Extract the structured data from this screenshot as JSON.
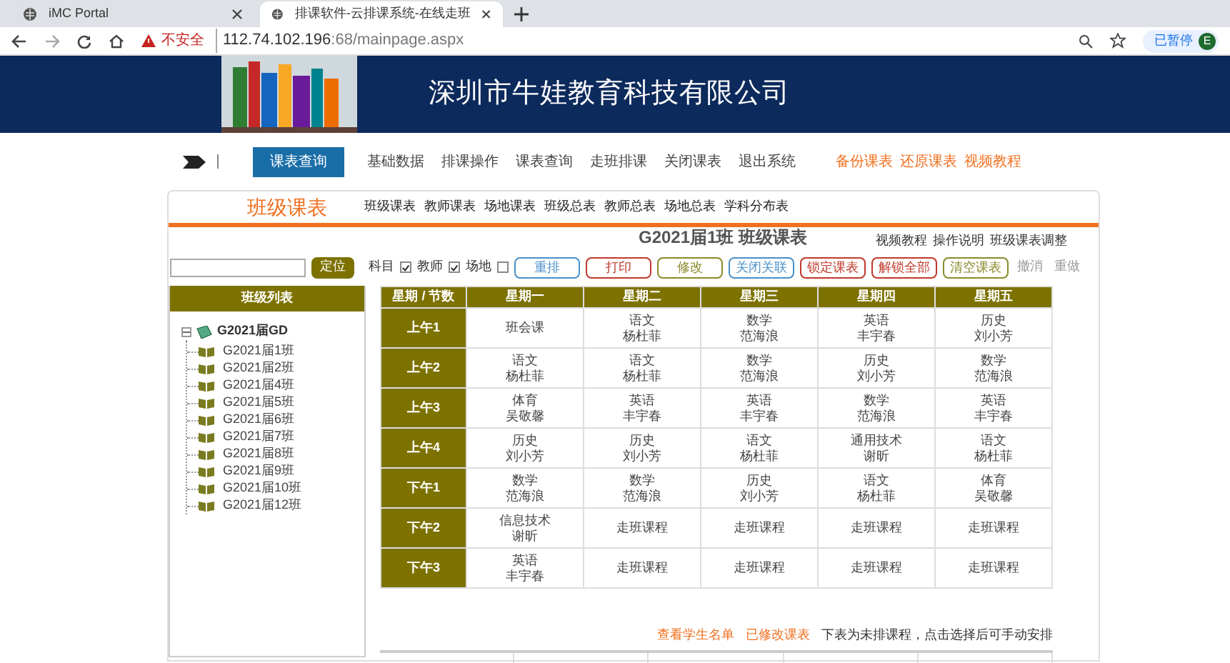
{
  "browser": {
    "tabs": [
      {
        "title": "iMC Portal",
        "selected": false
      },
      {
        "title": "排课软件-云排课系统-在线走班",
        "selected": true
      }
    ],
    "address": {
      "warning": "不安全",
      "host": "112.74.102.196",
      "rest": ":68/mainpage.aspx"
    },
    "profile": "已暂停",
    "avatar": "E"
  },
  "header": {
    "title": "深圳市牛娃教育科技有限公司"
  },
  "nav": {
    "items": [
      {
        "label": "课表查询",
        "selected": true
      },
      {
        "label": "基础数据",
        "selected": false
      },
      {
        "label": "排课操作",
        "selected": false
      },
      {
        "label": "课表查询",
        "selected": false
      },
      {
        "label": "走班排课",
        "selected": false
      },
      {
        "label": "关闭课表",
        "selected": false
      },
      {
        "label": "退出系统",
        "selected": false
      }
    ],
    "links": [
      "备份课表",
      "还原课表",
      "视频教程"
    ]
  },
  "panel": {
    "title": "班级课表",
    "tabs": [
      "班级课表",
      "教师课表",
      "场地课表",
      "班级总表",
      "教师总表",
      "场地总表",
      "学科分布表"
    ],
    "schedule_title": "G2021届1班  班级课表",
    "help_links": [
      "视频教程",
      "操作说明",
      "班级课表调整"
    ],
    "locate_button": "定位",
    "checkboxes": [
      {
        "label": "科目",
        "checked": true
      },
      {
        "label": "教师",
        "checked": true
      },
      {
        "label": "场地",
        "checked": false
      }
    ],
    "buttons": [
      {
        "label": "重排",
        "color": "#4a90c8",
        "disabled": false
      },
      {
        "label": "打印",
        "color": "#c0392b",
        "disabled": false
      },
      {
        "label": "修改",
        "color": "#8a8a2a",
        "disabled": false
      },
      {
        "label": "关闭关联",
        "color": "#4a90c8",
        "disabled": false
      },
      {
        "label": "锁定课表",
        "color": "#c0392b",
        "disabled": false
      },
      {
        "label": "解锁全部",
        "color": "#c0392b",
        "disabled": false
      },
      {
        "label": "清空课表",
        "color": "#8a8a2a",
        "disabled": false
      },
      {
        "label": "撤消",
        "color": "#999999",
        "disabled": true
      },
      {
        "label": "重做",
        "color": "#999999",
        "disabled": true
      }
    ],
    "class_list": {
      "title": "班级列表",
      "tree": [
        {
          "label": "G2021届GD",
          "expanded": true,
          "children": [
            {
              "label": "G2021届1班"
            },
            {
              "label": "G2021届2班"
            },
            {
              "label": "G2021届4班"
            },
            {
              "label": "G2021届5班"
            },
            {
              "label": "G2021届6班"
            },
            {
              "label": "G2021届7班"
            },
            {
              "label": "G2021届8班"
            },
            {
              "label": "G2021届9班"
            },
            {
              "label": "G2021届10班"
            },
            {
              "label": "G2021届12班"
            }
          ]
        }
      ]
    },
    "table": {
      "columns": [
        "星期 / 节数",
        "星期一",
        "星期二",
        "星期三",
        "星期四",
        "星期五"
      ],
      "rows": [
        {
          "cells": [
            [
              "上午1"
            ],
            [
              "班会课"
            ],
            [
              "语文",
              "杨杜菲"
            ],
            [
              "数学",
              "范海浪"
            ],
            [
              "英语",
              "丰宇春"
            ],
            [
              "历史",
              "刘小芳"
            ]
          ]
        },
        {
          "cells": [
            [
              "上午2"
            ],
            [
              "语文",
              "杨杜菲"
            ],
            [
              "语文",
              "杨杜菲"
            ],
            [
              "数学",
              "范海浪"
            ],
            [
              "历史",
              "刘小芳"
            ],
            [
              "数学",
              "范海浪"
            ]
          ]
        },
        {
          "cells": [
            [
              "上午3"
            ],
            [
              "体育",
              "吴敬馨"
            ],
            [
              "英语",
              "丰宇春"
            ],
            [
              "英语",
              "丰宇春"
            ],
            [
              "数学",
              "范海浪"
            ],
            [
              "英语",
              "丰宇春"
            ]
          ]
        },
        {
          "cells": [
            [
              "上午4"
            ],
            [
              "历史",
              "刘小芳"
            ],
            [
              "历史",
              "刘小芳"
            ],
            [
              "语文",
              "杨杜菲"
            ],
            [
              "通用技术",
              "谢昕"
            ],
            [
              "语文",
              "杨杜菲"
            ]
          ]
        },
        {
          "cells": [
            [
              "下午1"
            ],
            [
              "数学",
              "范海浪"
            ],
            [
              "数学",
              "范海浪"
            ],
            [
              "历史",
              "刘小芳"
            ],
            [
              "语文",
              "杨杜菲"
            ],
            [
              "体育",
              "吴敬馨"
            ]
          ]
        },
        {
          "cells": [
            [
              "下午2"
            ],
            [
              "信息技术",
              "谢昕"
            ],
            [
              "走班课程"
            ],
            [
              "走班课程"
            ],
            [
              "走班课程"
            ],
            [
              "走班课程"
            ]
          ]
        },
        {
          "cells": [
            [
              "下午3"
            ],
            [
              "英语",
              "丰宇春"
            ],
            [
              "走班课程"
            ],
            [
              "走班课程"
            ],
            [
              "走班课程"
            ],
            [
              "走班课程"
            ]
          ]
        }
      ]
    },
    "footer_links": [
      "查看学生名单",
      "已修改课表"
    ],
    "footer_note": "下表为未排课程，点击选择后可手动安排"
  }
}
